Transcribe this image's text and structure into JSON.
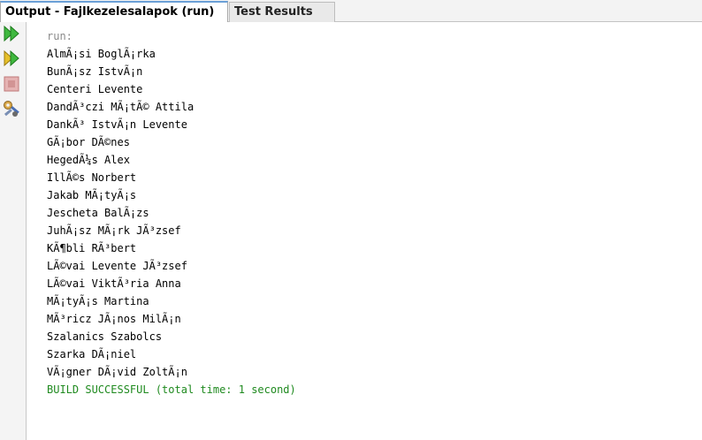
{
  "tabs": [
    {
      "label": "Output - Fajlkezelesalapok (run)",
      "active": true
    },
    {
      "label": "Test Results",
      "active": false
    }
  ],
  "toolbar": {
    "buttons": [
      {
        "icon": "rerun-icon",
        "color": "#3aa83a"
      },
      {
        "icon": "rerun-with-params-icon",
        "color": "#c9a020"
      },
      {
        "icon": "stop-icon",
        "color": "#c77a7a"
      },
      {
        "icon": "settings-icon",
        "color": "#4a6fb5"
      }
    ]
  },
  "output": {
    "run_label": "run:",
    "lines": [
      "AlmÃ¡si BoglÃ¡rka",
      "BunÃ¡sz IstvÃ¡n",
      "Centeri Levente",
      "DandÃ³czi MÃ¡tÃ© Attila",
      "DankÃ³ IstvÃ¡n Levente",
      "GÃ¡bor DÃ©nes",
      "HegedÃ¼s Alex",
      "IllÃ©s Norbert",
      "Jakab MÃ¡tyÃ¡s",
      "Jescheta BalÃ¡zs",
      "JuhÃ¡sz MÃ¡rk JÃ³zsef",
      "KÃ¶bli RÃ³bert",
      "LÃ©vai Levente JÃ³zsef",
      "LÃ©vai ViktÃ³ria Anna",
      "MÃ¡tyÃ¡s Martina",
      "MÃ³ricz JÃ¡nos MilÃ¡n",
      "Szalanics Szabolcs",
      "Szarka DÃ¡niel",
      "VÃ¡gner DÃ¡vid ZoltÃ¡n"
    ],
    "build_status": "BUILD SUCCESSFUL (total time: 1 second)",
    "colors": {
      "run": "#8a8a8a",
      "text": "#000000",
      "success": "#1f8a1f"
    }
  }
}
